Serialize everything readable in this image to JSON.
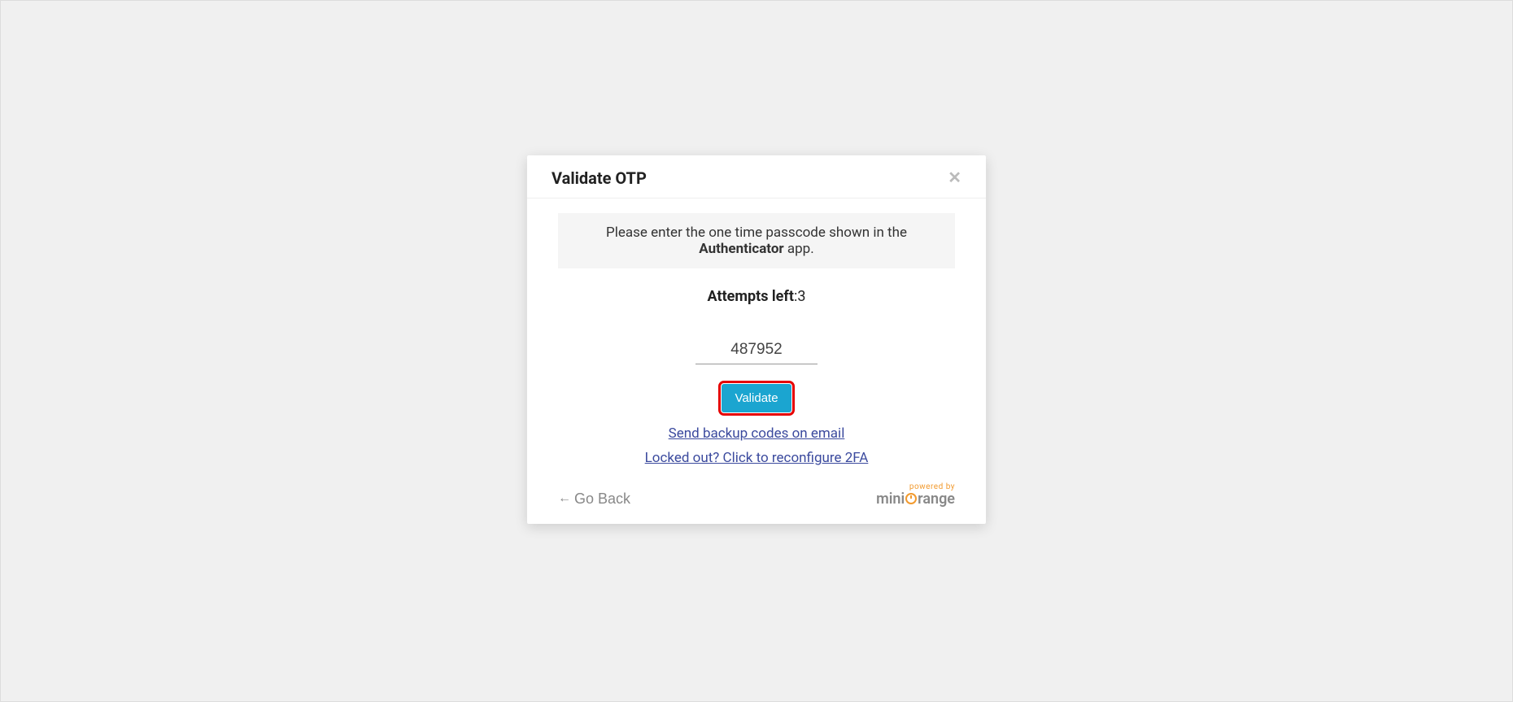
{
  "modal": {
    "title": "Validate OTP",
    "instruction_prefix": "Please enter the one time passcode shown in the ",
    "instruction_strong": "Authenticator",
    "instruction_suffix": " app.",
    "attempts_label": "Attempts left",
    "attempts_value": ":3",
    "otp_value": "487952",
    "validate_label": "Validate",
    "backup_link": "Send backup codes on email",
    "locked_link": "Locked out? Click to reconfigure 2FA",
    "go_back": "Go Back",
    "powered_by": "powered by",
    "brand_prefix": "mini",
    "brand_suffix": "range"
  }
}
